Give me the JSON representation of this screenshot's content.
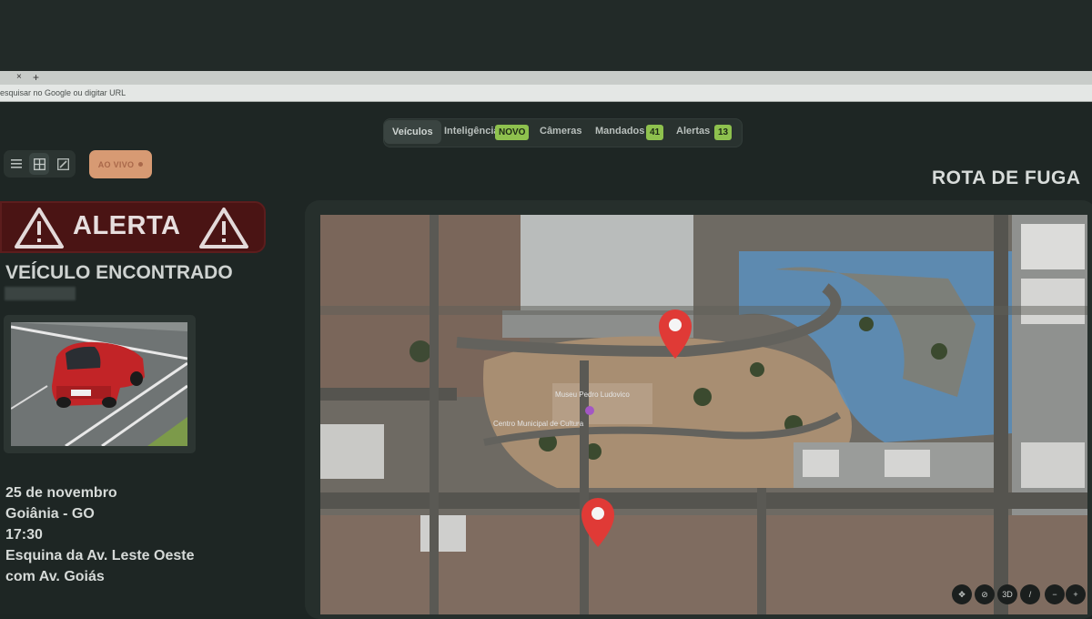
{
  "browser": {
    "tab_close": "×",
    "tab_new": "+",
    "url_placeholder": "esquisar no Google ou digitar URL"
  },
  "nav": {
    "items": [
      {
        "label": "Veículos",
        "active": true
      },
      {
        "label": "Inteligência",
        "badge": "NOVO"
      },
      {
        "label": "Câmeras"
      },
      {
        "label": "Mandados",
        "badge": "41"
      },
      {
        "label": "Alertas",
        "badge": "13"
      }
    ]
  },
  "toolbar": {
    "live_label": "AO VIVO"
  },
  "alert": {
    "title": "ALERTA",
    "subtitle": "VEÍCULO ENCONTRADO"
  },
  "details": {
    "date": "25 de novembro",
    "city": "Goiânia - GO",
    "time": "17:30",
    "location_line1": "Esquina da Av. Leste Oeste",
    "location_line2": "com Av. Goiás"
  },
  "map": {
    "title": "ROTA DE FUGA",
    "label_place1": "Museu Pedro Ludovico",
    "label_place2": "Centro Municipal de Cultura",
    "controls": [
      "pan-icon",
      "compass-off-icon",
      "3D",
      "compass-icon",
      "minus-icon",
      "plus-icon"
    ]
  },
  "colors": {
    "alert_bg": "#4a1414",
    "badge_green": "#8ec14e",
    "pin_red": "#e03a36",
    "live_button": "#d79a73",
    "highlight_blue": "#5aa0d8"
  }
}
